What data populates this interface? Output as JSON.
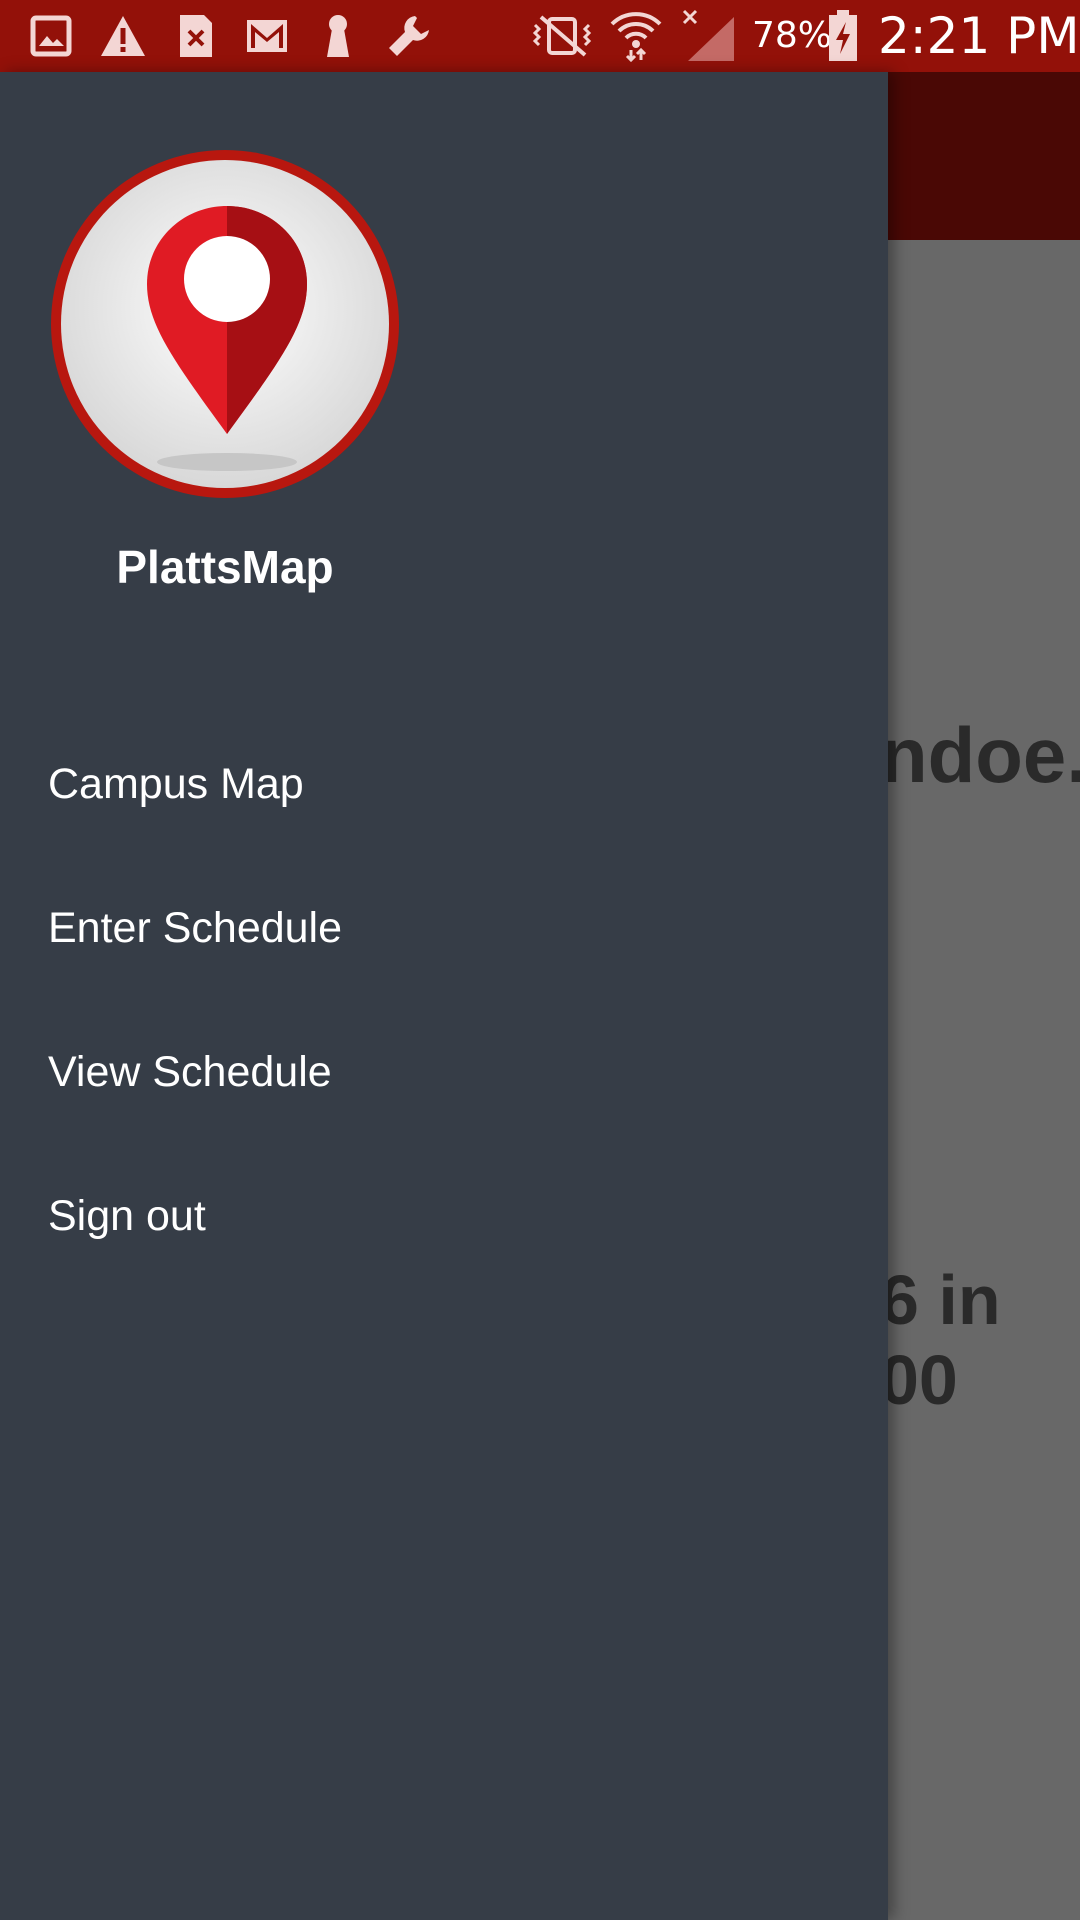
{
  "status_bar": {
    "battery": "78%",
    "time": "2:21 PM",
    "left_icons": [
      "gallery-icon",
      "warning-icon",
      "sim-error-icon",
      "gmail-icon",
      "keyhole-icon",
      "wrench-icon"
    ],
    "right_icons": [
      "vibrate-mute-icon",
      "wifi-icon",
      "no-signal-icon",
      "battery-charging-icon"
    ],
    "color": "#931109"
  },
  "background_app": {
    "toolbar_color": "#4a0805",
    "partial_texts": [
      "ndoe.",
      "6 in",
      "00"
    ]
  },
  "drawer": {
    "background": "#363d47",
    "app_name": "PlattsMap",
    "logo_icon": "map-pin-icon",
    "menu_items": [
      {
        "label": "Campus Map"
      },
      {
        "label": "Enter Schedule"
      },
      {
        "label": "View Schedule"
      },
      {
        "label": "Sign out"
      }
    ]
  }
}
